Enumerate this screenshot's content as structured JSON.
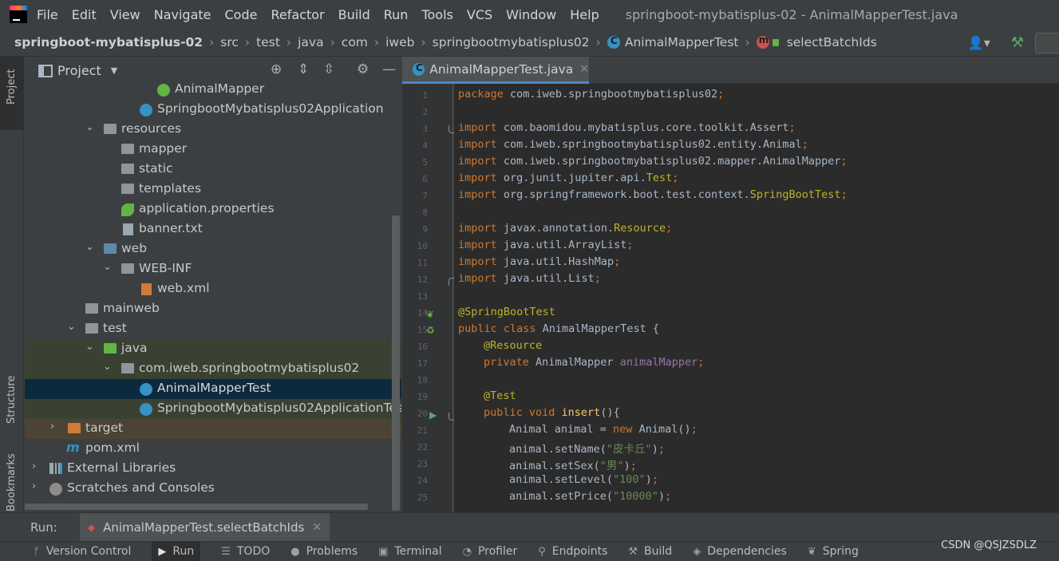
{
  "menubar": {
    "items": [
      "File",
      "Edit",
      "View",
      "Navigate",
      "Code",
      "Refactor",
      "Build",
      "Run",
      "Tools",
      "VCS",
      "Window",
      "Help"
    ],
    "window_title": "springboot-mybatisplus-02 - AnimalMapperTest.java"
  },
  "breadcrumb": {
    "items": [
      "springboot-mybatisplus-02",
      "src",
      "test",
      "java",
      "com",
      "iweb",
      "springbootmybatisplus02",
      "AnimalMapperTest",
      "selectBatchIds"
    ]
  },
  "left_strip": {
    "project": "Project",
    "structure": "Structure",
    "bookmarks": "Bookmarks"
  },
  "project_panel": {
    "title": "Project",
    "tree": [
      {
        "label": "AnimalMapper",
        "icon": "interface-icon"
      },
      {
        "label": "SpringbootMybatisplus02Application",
        "icon": "spring-class-icon"
      },
      {
        "label": "resources",
        "icon": "resources-folder-icon"
      },
      {
        "label": "mapper",
        "icon": "folder-icon"
      },
      {
        "label": "static",
        "icon": "folder-icon"
      },
      {
        "label": "templates",
        "icon": "folder-icon"
      },
      {
        "label": "application.properties",
        "icon": "spring-properties-icon"
      },
      {
        "label": "banner.txt",
        "icon": "text-file-icon"
      },
      {
        "label": "web",
        "icon": "web-folder-icon"
      },
      {
        "label": "WEB-INF",
        "icon": "folder-icon"
      },
      {
        "label": "web.xml",
        "icon": "xml-file-icon"
      },
      {
        "label": "mainweb",
        "icon": "folder-icon"
      },
      {
        "label": "test",
        "icon": "folder-icon"
      },
      {
        "label": "java",
        "icon": "test-source-folder-icon"
      },
      {
        "label": "com.iweb.springbootmybatisplus02",
        "icon": "package-icon"
      },
      {
        "label": "AnimalMapperTest",
        "icon": "test-class-icon"
      },
      {
        "label": "SpringbootMybatisplus02ApplicationTests",
        "icon": "test-class-icon"
      },
      {
        "label": "target",
        "icon": "excluded-folder-icon"
      },
      {
        "label": "pom.xml",
        "icon": "maven-icon"
      },
      {
        "label": "External Libraries",
        "icon": "libraries-icon"
      },
      {
        "label": "Scratches and Consoles",
        "icon": "scratches-icon"
      }
    ]
  },
  "editor": {
    "tab_label": "AnimalMapperTest.java",
    "line_numbers": [
      "1",
      "2",
      "3",
      "4",
      "5",
      "6",
      "7",
      "8",
      "9",
      "10",
      "11",
      "12",
      "13",
      "14",
      "15",
      "16",
      "17",
      "18",
      "19",
      "20",
      "21",
      "22",
      "23",
      "24",
      "25"
    ],
    "code": {
      "l1a": "package ",
      "l1b": "com.iweb.springbootmybatisplus02",
      "l1c": ";",
      "imp": "import ",
      "l3": "com.baomidou.mybatisplus.core.toolkit.Assert",
      "l4": "com.iweb.springbootmybatisplus02.entity.Animal",
      "l5": "com.iweb.springbootmybatisplus02.mapper.AnimalMapper",
      "l6a": "org.junit.jupiter.api.",
      "l6b": "Test",
      "l7a": "org.springframework.boot.test.context.",
      "l7b": "SpringBootTest",
      "l9a": "javax.annotation.",
      "l9b": "Resource",
      "l10": "java.util.ArrayList",
      "l11": "java.util.HashMap",
      "l12": "java.util.List",
      "semi": ";",
      "l14": "@SpringBootTest",
      "l15a": "public class ",
      "l15b": "AnimalMapperTest {",
      "l16": "@Resource",
      "l17a": "private ",
      "l17b": "AnimalMapper ",
      "l17c": "animalMapper",
      "l19": "@Test",
      "l20a": "public void ",
      "l20b": "insert",
      "l20c": "(){",
      "l21a": "Animal animal = ",
      "l21b": "new ",
      "l21c": "Animal()",
      "l22a": "animal.setName(",
      "l22b": "\"皮卡丘\"",
      "l22c": ")",
      "l23a": "animal.setSex(",
      "l23b": "\"男\"",
      "l23c": ")",
      "l24a": "animal.setLevel(",
      "l24b": "\"100\"",
      "l24c": ")",
      "l25a": "animal.setPrice(",
      "l25b": "\"10000\"",
      "l25c": ")"
    }
  },
  "run_bar": {
    "label": "Run:",
    "tab": "AnimalMapperTest.selectBatchIds"
  },
  "bottom_bar": {
    "items": [
      "Version Control",
      "Run",
      "TODO",
      "Problems",
      "Terminal",
      "Profiler",
      "Endpoints",
      "Build",
      "Dependencies",
      "Spring"
    ]
  },
  "watermark": "CSDN @QSJZSDLZ",
  "colors": {
    "background": "#3c3f41",
    "editor_bg": "#2b2b2b",
    "keyword": "#cc7832",
    "annotation": "#bbb529",
    "string": "#6a8759",
    "field": "#9876aa",
    "selection": "#0d293e"
  }
}
